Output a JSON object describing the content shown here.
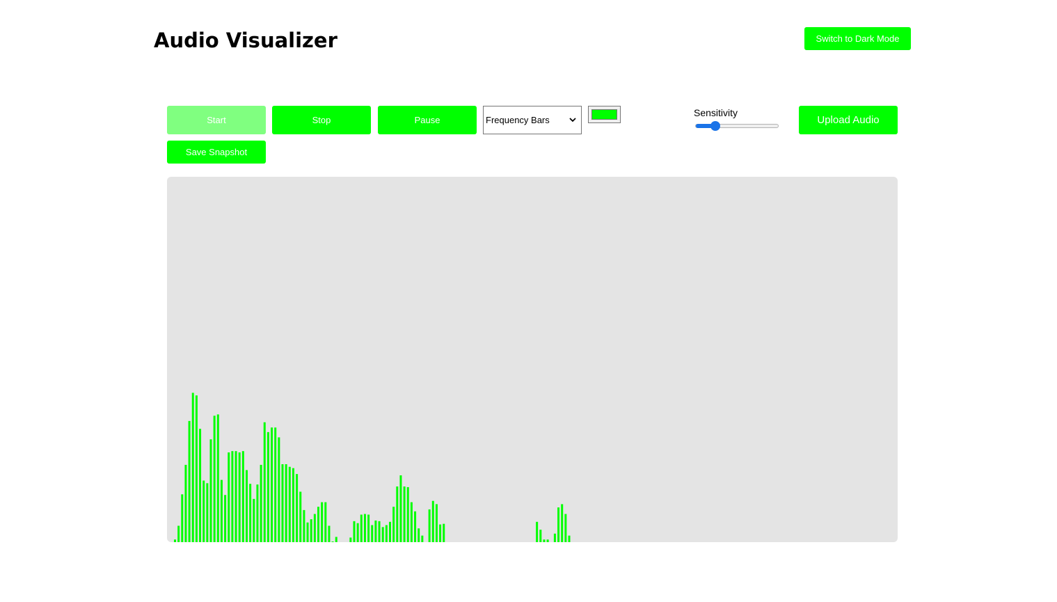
{
  "app": {
    "title": "Audio Visualizer",
    "theme_toggle_label": "Switch to Dark Mode"
  },
  "controls": {
    "start_label": "Start",
    "stop_label": "Stop",
    "pause_label": "Pause",
    "save_snapshot_label": "Save Snapshot",
    "upload_label": "Upload Audio",
    "mode_select": {
      "selected": "Frequency Bars"
    },
    "color_picker": {
      "value": "#00ff00"
    },
    "sensitivity": {
      "label": "Sensitivity",
      "value_fraction": 0.2
    }
  },
  "colors": {
    "accent": "#00ff00",
    "accent_disabled": "#80ff80",
    "canvas_bg": "#e4e4e4",
    "slider": "#1a73e8"
  },
  "icons": {
    "select_chevron": "chevron-down-icon"
  },
  "visualizer": {
    "bar_color": "#00ff00",
    "max_level": 255,
    "levels": [
      4,
      25,
      73,
      118,
      185,
      228,
      224,
      173,
      94,
      90,
      157,
      193,
      195,
      95,
      72,
      137,
      139,
      139,
      137,
      139,
      110,
      89,
      66,
      88,
      118,
      183,
      168,
      175,
      175,
      160,
      119,
      119,
      115,
      113,
      104,
      77,
      49,
      30,
      35,
      43,
      54,
      61,
      61,
      25,
      1,
      8,
      0,
      0,
      0,
      7,
      32,
      29,
      42,
      43,
      42,
      26,
      33,
      32,
      23,
      26,
      31,
      54,
      85,
      102,
      85,
      84,
      61,
      47,
      21,
      10,
      0,
      50,
      63,
      58,
      27,
      28,
      0,
      0,
      0,
      0,
      0,
      0,
      0,
      0,
      0,
      0,
      0,
      0,
      0,
      0,
      0,
      0,
      0,
      0,
      0,
      0,
      0,
      0,
      0,
      0,
      0,
      31,
      19,
      4,
      4,
      0,
      13,
      53,
      58,
      43,
      10
    ]
  }
}
